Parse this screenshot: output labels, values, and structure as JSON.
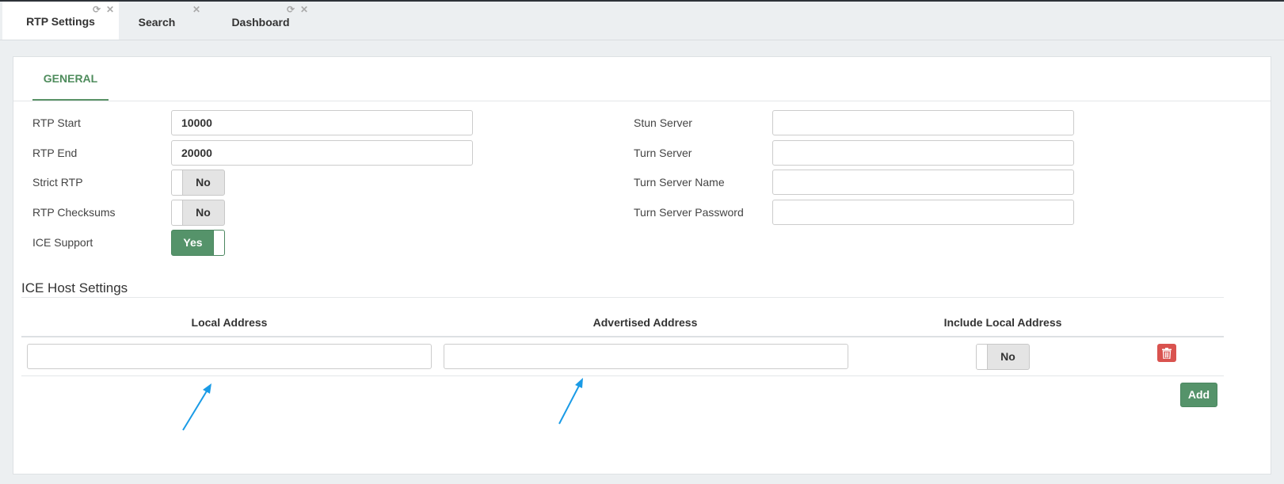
{
  "tabs": [
    {
      "label": "RTP Settings",
      "active": true
    },
    {
      "label": "Search",
      "active": false
    },
    {
      "label": "Dashboard",
      "active": false
    }
  ],
  "panel": {
    "subtab": "GENERAL"
  },
  "left_fields": {
    "rtp_start": {
      "label": "RTP Start",
      "value": "10000"
    },
    "rtp_end": {
      "label": "RTP End",
      "value": "20000"
    },
    "strict_rtp": {
      "label": "Strict RTP",
      "value": "No"
    },
    "rtp_checksums": {
      "label": "RTP Checksums",
      "value": "No"
    },
    "ice_support": {
      "label": "ICE Support",
      "value": "Yes"
    }
  },
  "right_fields": {
    "stun_server": {
      "label": "Stun Server",
      "value": ""
    },
    "turn_server": {
      "label": "Turn Server",
      "value": ""
    },
    "turn_server_name": {
      "label": "Turn Server Name",
      "value": ""
    },
    "turn_server_password": {
      "label": "Turn Server Password",
      "value": ""
    }
  },
  "ice_host": {
    "title": "ICE Host Settings",
    "columns": [
      "Local Address",
      "Advertised Address",
      "Include Local Address"
    ],
    "rows": [
      {
        "local_address": "",
        "advertised_address": "",
        "include_local_address": "No"
      }
    ],
    "add_label": "Add"
  },
  "colors": {
    "accent_green": "#55936a",
    "danger_red": "#d9534f",
    "annotation_blue": "#1a9be6"
  },
  "icons": {
    "refresh": "refresh-icon",
    "close": "close-icon",
    "trash": "trash-icon",
    "arrow": "annotation-arrow"
  }
}
